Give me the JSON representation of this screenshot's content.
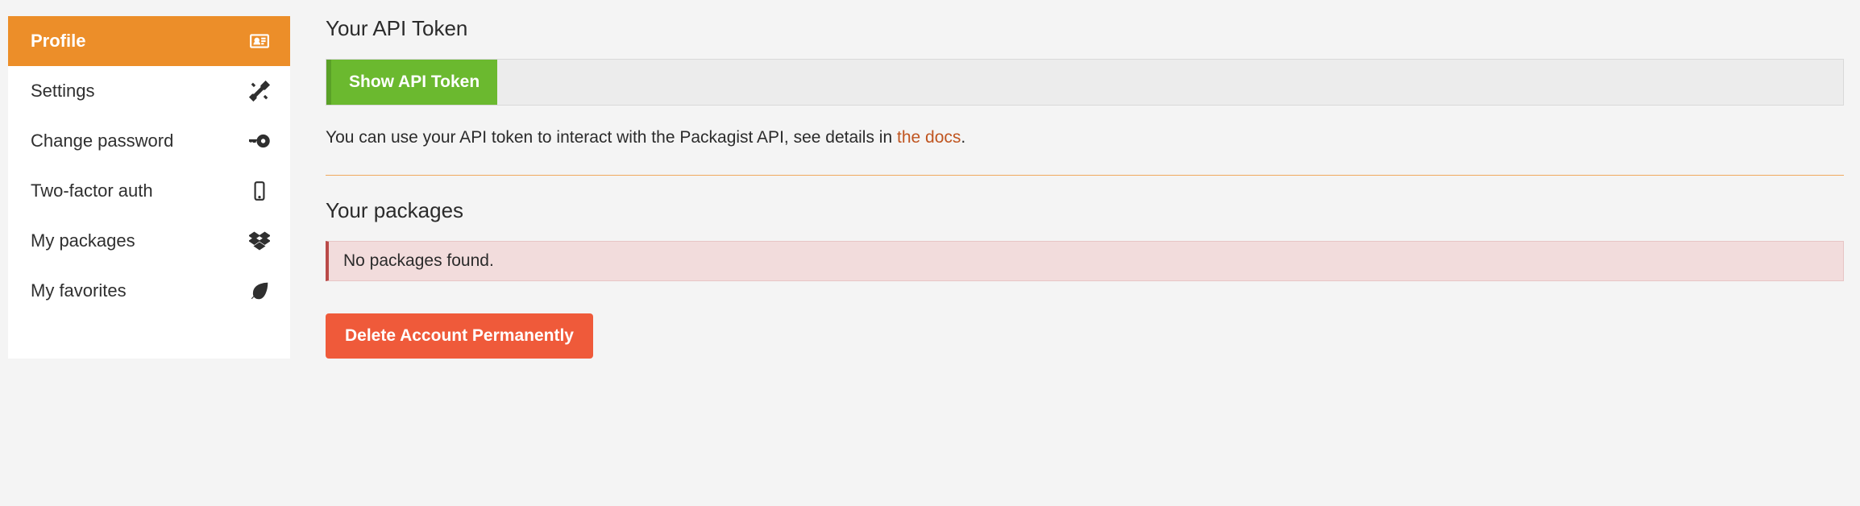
{
  "sidebar": {
    "items": [
      {
        "label": "Profile",
        "active": true
      },
      {
        "label": "Settings",
        "active": false
      },
      {
        "label": "Change password",
        "active": false
      },
      {
        "label": "Two-factor auth",
        "active": false
      },
      {
        "label": "My packages",
        "active": false
      },
      {
        "label": "My favorites",
        "active": false
      }
    ]
  },
  "main": {
    "api_token": {
      "title": "Your API Token",
      "show_label": "Show API Token",
      "description_pre": "You can use your API token to interact with the Packagist API, see details in ",
      "docs_link": "the docs",
      "description_post": "."
    },
    "packages": {
      "title": "Your packages",
      "empty_message": "No packages found."
    },
    "delete_label": "Delete Account Permanently"
  }
}
